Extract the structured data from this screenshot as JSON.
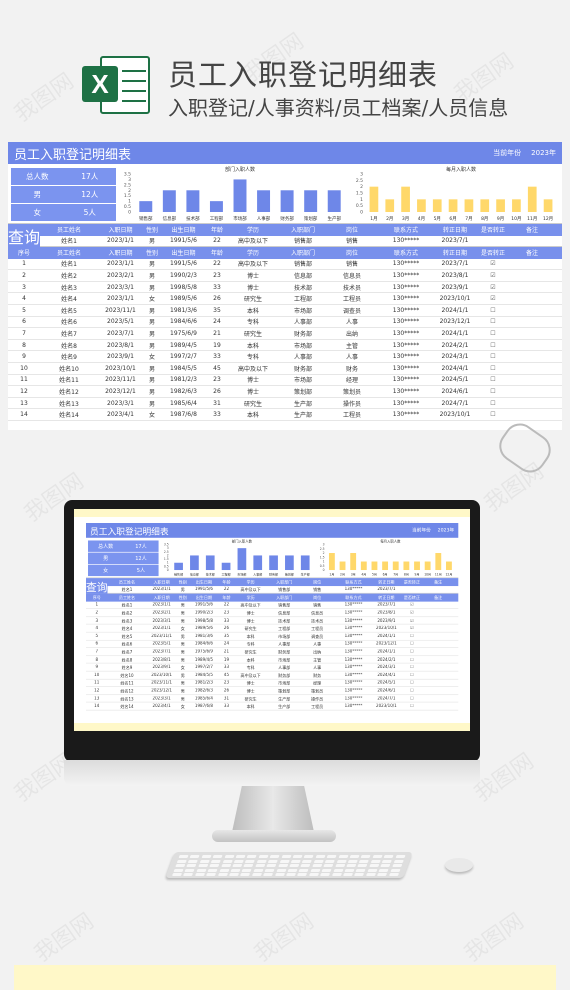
{
  "header": {
    "title": "员工入职登记明细表",
    "subtitle": "入职登记/人事资料/员工档案/人员信息"
  },
  "sheet": {
    "title": "员工入职登记明细表",
    "year_label": "当前年份",
    "year_value": "2023年",
    "stats": [
      {
        "label": "总人数",
        "value": "17人"
      },
      {
        "label": "男",
        "value": "12人"
      },
      {
        "label": "女",
        "value": "5人"
      }
    ],
    "query_label": "查询",
    "columns": [
      "员工姓名",
      "入职日期",
      "性别",
      "出生日期",
      "年龄",
      "学历",
      "入职部门",
      "岗位",
      "联系方式",
      "转正日期",
      "是否转正",
      "备注"
    ],
    "query_row": [
      "姓名1",
      "2023/1/1",
      "男",
      "1991/5/6",
      "22",
      "高中及以下",
      "销售部",
      "销售",
      "130*****",
      "2023/7/1",
      "",
      ""
    ],
    "list_columns": [
      "序号",
      "员工姓名",
      "入职日期",
      "性别",
      "出生日期",
      "年龄",
      "学历",
      "入职部门",
      "岗位",
      "联系方式",
      "转正日期",
      "是否转正",
      "备注"
    ],
    "rows": [
      [
        "1",
        "姓名1",
        "2023/1/1",
        "男",
        "1991/5/6",
        "22",
        "高中及以下",
        "销售部",
        "销售",
        "130*****",
        "2023/7/1",
        "☑",
        ""
      ],
      [
        "2",
        "姓名2",
        "2023/2/1",
        "男",
        "1990/2/3",
        "23",
        "博士",
        "信息部",
        "信息员",
        "130*****",
        "2023/8/1",
        "☑",
        ""
      ],
      [
        "3",
        "姓名3",
        "2023/3/1",
        "男",
        "1998/5/8",
        "33",
        "博士",
        "技术部",
        "技术员",
        "130*****",
        "2023/9/1",
        "☑",
        ""
      ],
      [
        "4",
        "姓名4",
        "2023/1/1",
        "女",
        "1989/5/6",
        "26",
        "研究生",
        "工程部",
        "工程员",
        "130*****",
        "2023/10/1",
        "☑",
        ""
      ],
      [
        "5",
        "姓名5",
        "2023/11/1",
        "男",
        "1981/3/6",
        "35",
        "本科",
        "市场部",
        "调查员",
        "130*****",
        "2024/1/1",
        "☐",
        ""
      ],
      [
        "6",
        "姓名6",
        "2023/5/1",
        "男",
        "1984/6/6",
        "24",
        "专科",
        "人事部",
        "人事",
        "130*****",
        "2023/12/1",
        "☐",
        ""
      ],
      [
        "7",
        "姓名7",
        "2023/7/1",
        "男",
        "1975/6/9",
        "21",
        "研究生",
        "财务部",
        "出纳",
        "130*****",
        "2024/1/1",
        "☐",
        ""
      ],
      [
        "8",
        "姓名8",
        "2023/8/1",
        "男",
        "1989/4/5",
        "19",
        "本科",
        "市场部",
        "主管",
        "130*****",
        "2024/2/1",
        "☐",
        ""
      ],
      [
        "9",
        "姓名9",
        "2023/9/1",
        "女",
        "1997/2/7",
        "33",
        "专科",
        "人事部",
        "人事",
        "130*****",
        "2024/3/1",
        "☐",
        ""
      ],
      [
        "10",
        "姓名10",
        "2023/10/1",
        "男",
        "1984/5/5",
        "45",
        "高中及以下",
        "财务部",
        "财务",
        "130*****",
        "2024/4/1",
        "☐",
        ""
      ],
      [
        "11",
        "姓名11",
        "2023/11/1",
        "男",
        "1981/2/3",
        "23",
        "博士",
        "市场部",
        "经理",
        "130*****",
        "2024/5/1",
        "☐",
        ""
      ],
      [
        "12",
        "姓名12",
        "2023/12/1",
        "男",
        "1982/6/3",
        "26",
        "博士",
        "策划部",
        "策划员",
        "130*****",
        "2024/6/1",
        "☐",
        ""
      ],
      [
        "13",
        "姓名13",
        "2023/3/1",
        "男",
        "1985/6/4",
        "31",
        "研究生",
        "生产部",
        "操作员",
        "130*****",
        "2024/7/1",
        "☐",
        ""
      ],
      [
        "14",
        "姓名14",
        "2023/4/1",
        "女",
        "1987/6/8",
        "33",
        "本科",
        "生产部",
        "工程员",
        "130*****",
        "2023/10/1",
        "☐",
        ""
      ]
    ]
  },
  "chart_data": [
    {
      "type": "bar",
      "title": "部门入职人数",
      "categories": [
        "销售部",
        "信息部",
        "技术部",
        "工程部",
        "市场部",
        "人事部",
        "财务部",
        "策划部",
        "生产部"
      ],
      "values": [
        1,
        2,
        2,
        1,
        3,
        2,
        2,
        2,
        2
      ],
      "ylim": [
        0,
        3.5
      ],
      "yticks": [
        "0",
        "0.5",
        "1",
        "1.5",
        "2",
        "2.5",
        "3",
        "3.5"
      ],
      "color": "#6e87e8"
    },
    {
      "type": "bar",
      "title": "每月入职人数",
      "categories": [
        "1月",
        "2月",
        "3月",
        "4月",
        "5月",
        "6月",
        "7月",
        "8月",
        "9月",
        "10月",
        "11月",
        "12月"
      ],
      "values": [
        2,
        1,
        2,
        1,
        1,
        1,
        1,
        1,
        1,
        1,
        2,
        1
      ],
      "ylim": [
        0,
        3
      ],
      "yticks": [
        "0",
        "0.5",
        "1",
        "1.5",
        "2",
        "2.5",
        "3"
      ],
      "color": "#ffd86a"
    }
  ],
  "watermark": "我图网"
}
